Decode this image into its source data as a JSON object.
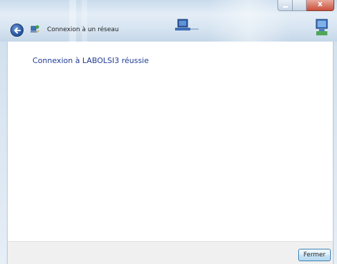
{
  "window": {
    "title": "Connexion à un réseau",
    "caption_buttons": [
      "minimize",
      "maximize",
      "close"
    ]
  },
  "icons": {
    "back": "back-arrow-icon",
    "network_wizard": "network-wizard-icon",
    "header_network_left": "network-computer-icon",
    "header_network_right": "network-computer-icon"
  },
  "content": {
    "message": "Connexion à LABOLSI3 réussie"
  },
  "footer": {
    "close_label": "Fermer"
  },
  "colors": {
    "message_text": "#1f3a93",
    "glass": "#d6e4f1",
    "close_caption": "#c9503c"
  }
}
